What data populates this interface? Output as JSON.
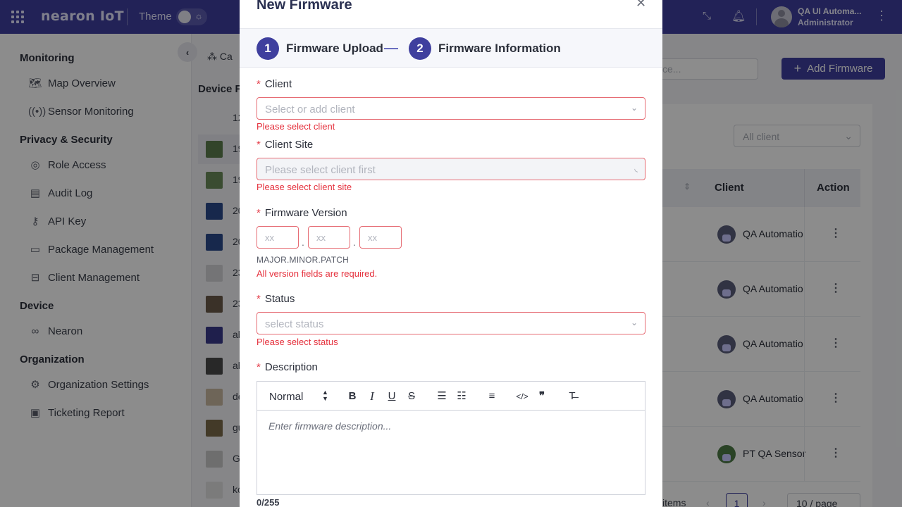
{
  "topbar": {
    "brand": "nearon IoT",
    "theme_label": "Theme",
    "user_name": "QA UI Automa...",
    "user_role": "Administrator"
  },
  "sidebar": {
    "sections": [
      {
        "title": "Monitoring",
        "items": [
          {
            "label": "Map Overview",
            "icon": "map-icon"
          },
          {
            "label": "Sensor Monitoring",
            "icon": "sensor-icon"
          }
        ]
      },
      {
        "title": "Privacy & Security",
        "items": [
          {
            "label": "Role Access",
            "icon": "role-icon"
          },
          {
            "label": "Audit Log",
            "icon": "audit-icon"
          },
          {
            "label": "API Key",
            "icon": "key-icon"
          },
          {
            "label": "Package Management",
            "icon": "package-icon"
          },
          {
            "label": "Client Management",
            "icon": "briefcase-icon"
          }
        ]
      },
      {
        "title": "Device",
        "items": [
          {
            "label": "Nearon",
            "icon": "infinity-icon"
          }
        ]
      },
      {
        "title": "Organization",
        "items": [
          {
            "label": "Organization Settings",
            "icon": "gear-icon"
          },
          {
            "label": "Ticketing Report",
            "icon": "report-icon"
          }
        ]
      }
    ]
  },
  "background": {
    "breadcrumb": "Ca",
    "title": "Device Fi",
    "list_rows": [
      "12",
      "19",
      "19",
      "20",
      "20",
      "23",
      "23",
      "ab",
      "ab",
      "de",
      "gu",
      "G",
      "ko"
    ],
    "search_placeholder": "ce...",
    "add_button": "Add Firmware",
    "client_filter": "All client",
    "table_headers": {
      "client": "Client",
      "action": "Action"
    },
    "rows": [
      "QA Automatio",
      "QA Automatio",
      "QA Automatio",
      "QA Automatio",
      "PT QA Sensor"
    ],
    "pager": {
      "items": "items",
      "page": "1",
      "per_page": "10 / page"
    }
  },
  "modal": {
    "title": "New Firmware",
    "steps": [
      {
        "num": "1",
        "label": "Firmware Upload"
      },
      {
        "num": "2",
        "label": "Firmware Information"
      }
    ],
    "required_mark": "*",
    "client": {
      "label": "Client",
      "placeholder": "Select or add client",
      "error": "Please select client"
    },
    "client_site": {
      "label": "Client Site",
      "placeholder": "Please select client first",
      "error": "Please select client site"
    },
    "version": {
      "label": "Firmware Version",
      "placeholders": [
        "xx",
        "xx",
        "xx"
      ],
      "separator": ".",
      "hint": "MAJOR.MINOR.PATCH",
      "error": "All version fields are required."
    },
    "status": {
      "label": "Status",
      "placeholder": "select status",
      "error": "Please select status"
    },
    "description": {
      "label": "Description",
      "format_select": "Normal",
      "placeholder": "Enter firmware description...",
      "counter": "0/255"
    }
  },
  "colors": {
    "primary": "#3f3f9e",
    "error": "#e5303c",
    "error_border": "#e66b73"
  }
}
